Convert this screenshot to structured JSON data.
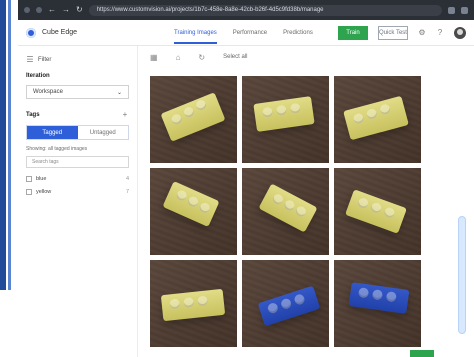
{
  "browser": {
    "url": "https://www.customvision.ai/projects/1b7c-458e-8a8e-42cb-b26f-4d5c9fd38b/manage"
  },
  "app": {
    "name": "Cube Edge",
    "tabs": [
      "Training Images",
      "Performance",
      "Predictions"
    ],
    "active_tab": "Training Images",
    "train_label": "Train",
    "test_label": "Quick Test"
  },
  "sidebar": {
    "filter_label": "Filter",
    "iteration_label": "Iteration",
    "workspace_value": "Workspace",
    "tags_label": "Tags",
    "tagged_label": "Tagged",
    "untagged_label": "Untagged",
    "hint": "Showing: all tagged images",
    "search_placeholder": "Search tags",
    "items": [
      {
        "label": "blue",
        "count": "4"
      },
      {
        "label": "yellow",
        "count": "7"
      }
    ]
  },
  "toolbar": {
    "select_all_label": "Select all"
  },
  "colors": {
    "accent": "#2f5fd8",
    "train_button": "#2ea44f",
    "chrome": "#2b2f36",
    "left_accent": "#1f4b99"
  },
  "gallery": {
    "images": [
      {
        "color": "yellow",
        "pose": "tilted-left"
      },
      {
        "color": "yellow",
        "pose": "flat"
      },
      {
        "color": "yellow",
        "pose": "angled"
      },
      {
        "color": "yellow",
        "pose": "tilted-right"
      },
      {
        "color": "yellow",
        "pose": "diagonal"
      },
      {
        "color": "yellow",
        "pose": "angled-down"
      },
      {
        "color": "yellow",
        "pose": "low"
      },
      {
        "color": "blue",
        "pose": "tilted-left"
      },
      {
        "color": "blue",
        "pose": "flat"
      }
    ]
  }
}
